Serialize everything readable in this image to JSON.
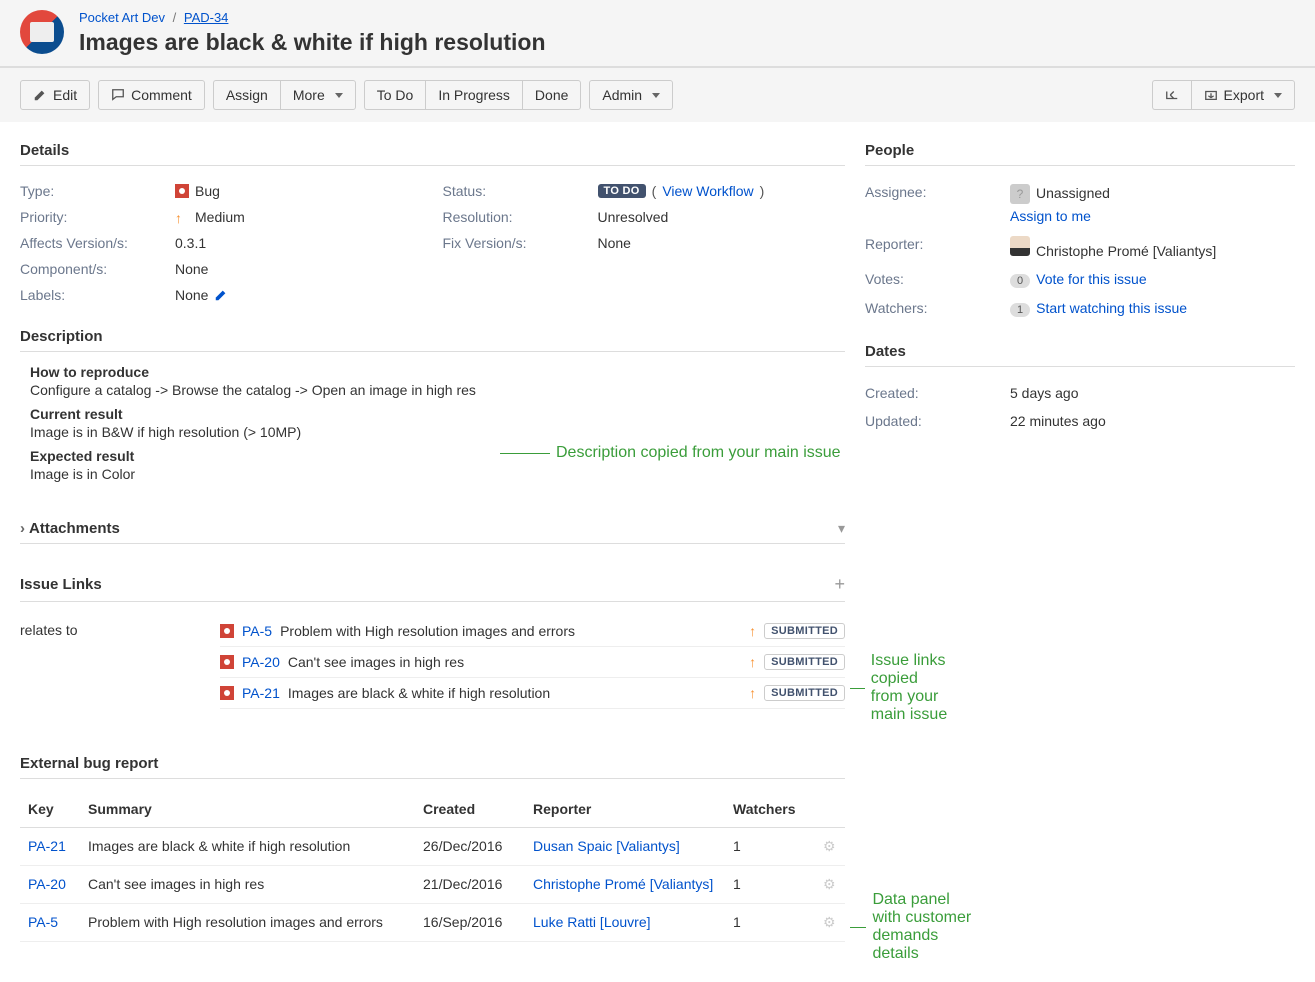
{
  "breadcrumb": {
    "project": "Pocket Art Dev",
    "issue_key": "PAD-34"
  },
  "issue_title": "Images are black & white if high resolution",
  "toolbar": {
    "edit": "Edit",
    "comment": "Comment",
    "assign": "Assign",
    "more": "More",
    "todo": "To Do",
    "inprogress": "In Progress",
    "done": "Done",
    "admin": "Admin",
    "export": "Export"
  },
  "sections": {
    "details": "Details",
    "description": "Description",
    "attachments": "Attachments",
    "issue_links": "Issue Links",
    "external": "External bug report",
    "people": "People",
    "dates": "Dates"
  },
  "details": {
    "type_label": "Type:",
    "type_value": "Bug",
    "priority_label": "Priority:",
    "priority_value": "Medium",
    "affects_label": "Affects Version/s:",
    "affects_value": "0.3.1",
    "components_label": "Component/s:",
    "components_value": "None",
    "labels_label": "Labels:",
    "labels_value": "None",
    "status_label": "Status:",
    "status_value": "TO DO",
    "view_workflow": "View Workflow",
    "resolution_label": "Resolution:",
    "resolution_value": "Unresolved",
    "fixversion_label": "Fix Version/s:",
    "fixversion_value": "None"
  },
  "description": {
    "h1": "How to reproduce",
    "p1": "Configure a catalog -> Browse the catalog -> Open an image in high res",
    "h2": "Current result",
    "p2": "Image is in B&W if high resolution (> 10MP)",
    "h3": "Expected result",
    "p3": "Image is in Color"
  },
  "issue_links": {
    "type": "relates to",
    "items": [
      {
        "key": "PA-5",
        "summary": "Problem with High resolution images and errors",
        "status": "SUBMITTED"
      },
      {
        "key": "PA-20",
        "summary": "Can't see images in high res",
        "status": "SUBMITTED"
      },
      {
        "key": "PA-21",
        "summary": "Images are black & white if high resolution",
        "status": "SUBMITTED"
      }
    ]
  },
  "external_table": {
    "headers": {
      "key": "Key",
      "summary": "Summary",
      "created": "Created",
      "reporter": "Reporter",
      "watchers": "Watchers"
    },
    "rows": [
      {
        "key": "PA-21",
        "summary": "Images are black & white if high resolution",
        "created": "26/Dec/2016",
        "reporter": "Dusan Spaic [Valiantys]",
        "watchers": "1"
      },
      {
        "key": "PA-20",
        "summary": "Can't see images in high res",
        "created": "21/Dec/2016",
        "reporter": "Christophe Promé [Valiantys]",
        "watchers": "1"
      },
      {
        "key": "PA-5",
        "summary": "Problem with High resolution images and errors",
        "created": "16/Sep/2016",
        "reporter": "Luke Ratti [Louvre]",
        "watchers": "1"
      }
    ]
  },
  "people": {
    "assignee_label": "Assignee:",
    "assignee_value": "Unassigned",
    "assign_to_me": "Assign to me",
    "reporter_label": "Reporter:",
    "reporter_value": "Christophe Promé [Valiantys]",
    "votes_label": "Votes:",
    "votes_count": "0",
    "votes_link": "Vote for this issue",
    "watchers_label": "Watchers:",
    "watchers_count": "1",
    "watchers_link": "Start watching this issue"
  },
  "dates": {
    "created_label": "Created:",
    "created_value": "5 days ago",
    "updated_label": "Updated:",
    "updated_value": "22 minutes ago"
  },
  "annotations": {
    "desc": "Description copied from your main issue",
    "links": "Issue links copied from your main issue",
    "panel": "Data panel with customer demands details"
  }
}
